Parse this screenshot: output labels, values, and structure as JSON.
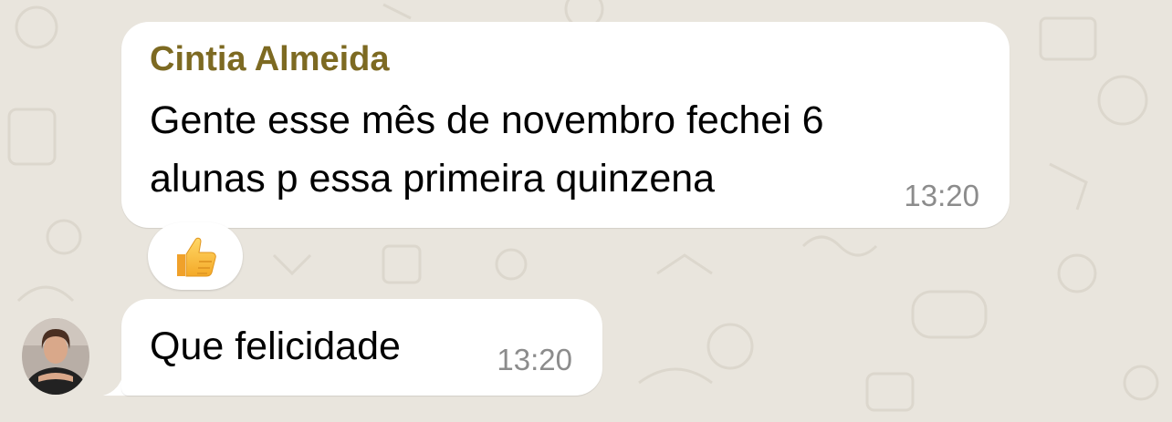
{
  "messages": [
    {
      "sender": "Cintia Almeida",
      "text_lines": [
        "Gente esse mês de novembro fechei 6",
        "alunas p essa primeira quinzena"
      ],
      "time": "13:20",
      "reaction": "thumbs-up-icon"
    },
    {
      "text": "Que felicidade",
      "time": "13:20",
      "avatar": "avatar"
    }
  ],
  "colors": {
    "background": "#e9e5dd",
    "bubble": "#ffffff",
    "sender_name": "#7d6a22",
    "timestamp": "#8c8c8c"
  }
}
